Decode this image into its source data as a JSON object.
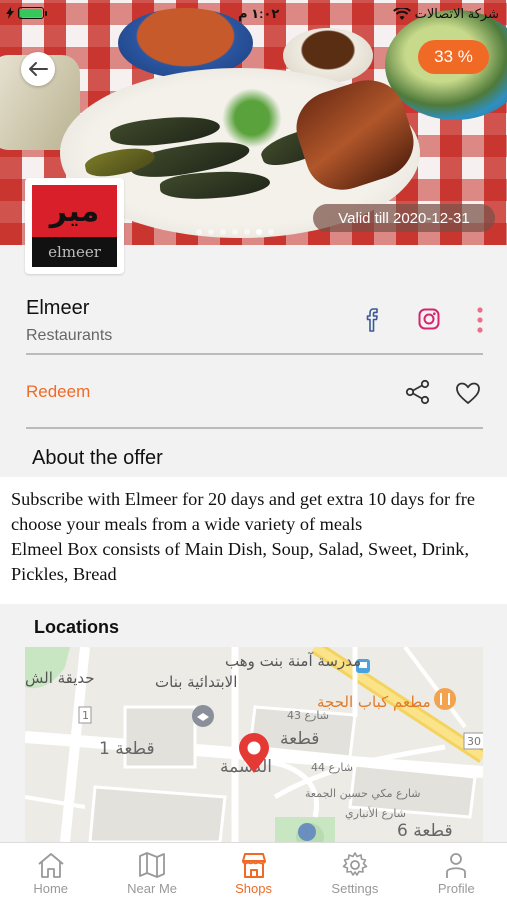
{
  "status_bar": {
    "time": "١:٠٢ م",
    "carrier": "شركة الاتصالات"
  },
  "hero": {
    "discount": "33 %",
    "valid_till": "Valid till 2020-12-31",
    "slides": 7,
    "active_slide": 5
  },
  "store": {
    "logo_text": "مير",
    "logo_subtext": "elmeer",
    "name": "Elmeer",
    "category": "Restaurants",
    "redeem_label": "Redeem"
  },
  "about": {
    "title": "About the offer",
    "lines": [
      "Subscribe with Elmeer for 20 days and get extra 10 days for fre",
      "choose your meals from a wide variety of meals",
      "Elmeel Box consists of Main Dish, Soup, Salad, Sweet, Drink,",
      "Pickles, Bread"
    ]
  },
  "locations": {
    "title": "Locations",
    "map_labels": {
      "school_line1": "مدرسة آمنة بنت وهب",
      "school_line2": "الابتدائية بنات",
      "park": "حديقة الش",
      "restaurant": "مطعم كباب الحجة",
      "street43": "شارع 43",
      "street44": "شارع 44",
      "block1": "قطعة 1",
      "block_top": "قطعة",
      "block6": "قطعة 6",
      "district": "الدسمة",
      "street_mecca": "شارع مكي حسين الجمعة",
      "street_anbari": "شارع الأنباري",
      "road30": "30",
      "road1": "1"
    }
  },
  "tabs": [
    {
      "label": "Home",
      "icon": "home-icon",
      "active": false
    },
    {
      "label": "Near Me",
      "icon": "map-icon",
      "active": false
    },
    {
      "label": "Shops",
      "icon": "shop-icon",
      "active": true
    },
    {
      "label": "Settings",
      "icon": "gear-icon",
      "active": false
    },
    {
      "label": "Profile",
      "icon": "person-icon",
      "active": false
    }
  ],
  "colors": {
    "accent": "#f06a26",
    "instagram": "#d6246f",
    "facebook": "#3b5998",
    "map_pin": "#e53935"
  }
}
